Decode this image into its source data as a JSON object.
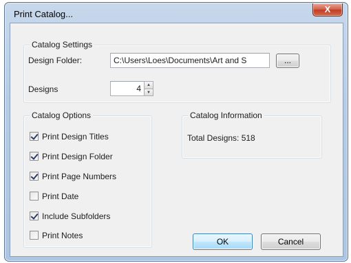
{
  "window": {
    "title": "Print Catalog...",
    "close_label": "X"
  },
  "catalog_settings": {
    "legend": "Catalog Settings",
    "folder_label": "Design Folder:",
    "folder_value": "C:\\Users\\Loes\\Documents\\Art and S",
    "browse_label": "...",
    "designs_label": "Designs",
    "designs_value": "4"
  },
  "catalog_options": {
    "legend": "Catalog Options",
    "items": [
      {
        "label": "Print Design Titles",
        "checked": true
      },
      {
        "label": "Print Design Folder",
        "checked": true
      },
      {
        "label": "Print Page Numbers",
        "checked": true
      },
      {
        "label": "Print Date",
        "checked": false
      },
      {
        "label": "Include Subfolders",
        "checked": true
      },
      {
        "label": "Print Notes",
        "checked": false
      }
    ]
  },
  "catalog_information": {
    "legend": "Catalog Information",
    "total_text": "Total Designs: 518"
  },
  "buttons": {
    "ok_label": "OK",
    "cancel_label": "Cancel"
  }
}
